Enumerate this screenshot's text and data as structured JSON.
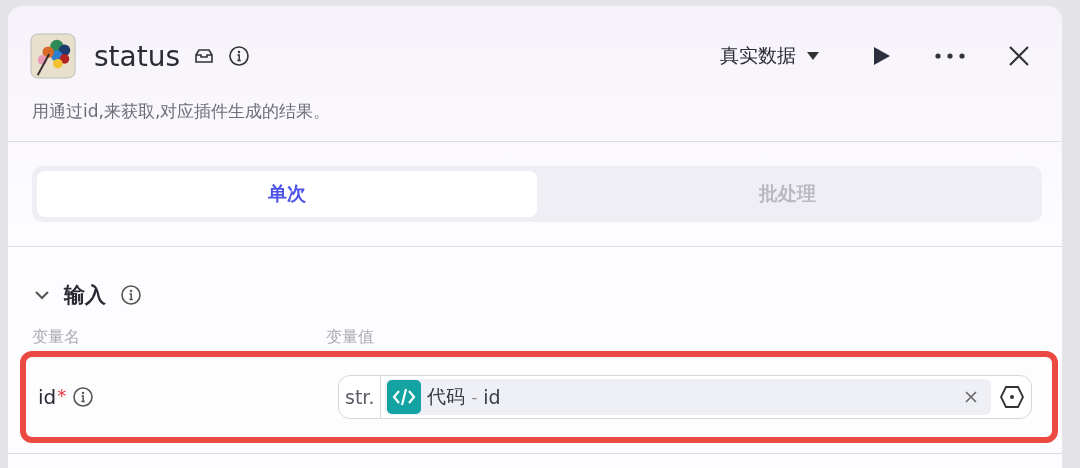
{
  "header": {
    "title": "status",
    "data_mode": "真实数据",
    "description": "用通过id,来获取,对应插件生成的结果。"
  },
  "tabs": [
    {
      "label": "单次",
      "selected": true
    },
    {
      "label": "批处理",
      "selected": false
    }
  ],
  "input_section": {
    "title": "输入",
    "expanded": true,
    "columns": [
      "变量名",
      "变量值"
    ],
    "rows": [
      {
        "name": "id",
        "required_mark": "*",
        "highlighted": true,
        "type": "str.",
        "value_source": "代码",
        "separator": "-",
        "value_name": "id"
      }
    ]
  }
}
